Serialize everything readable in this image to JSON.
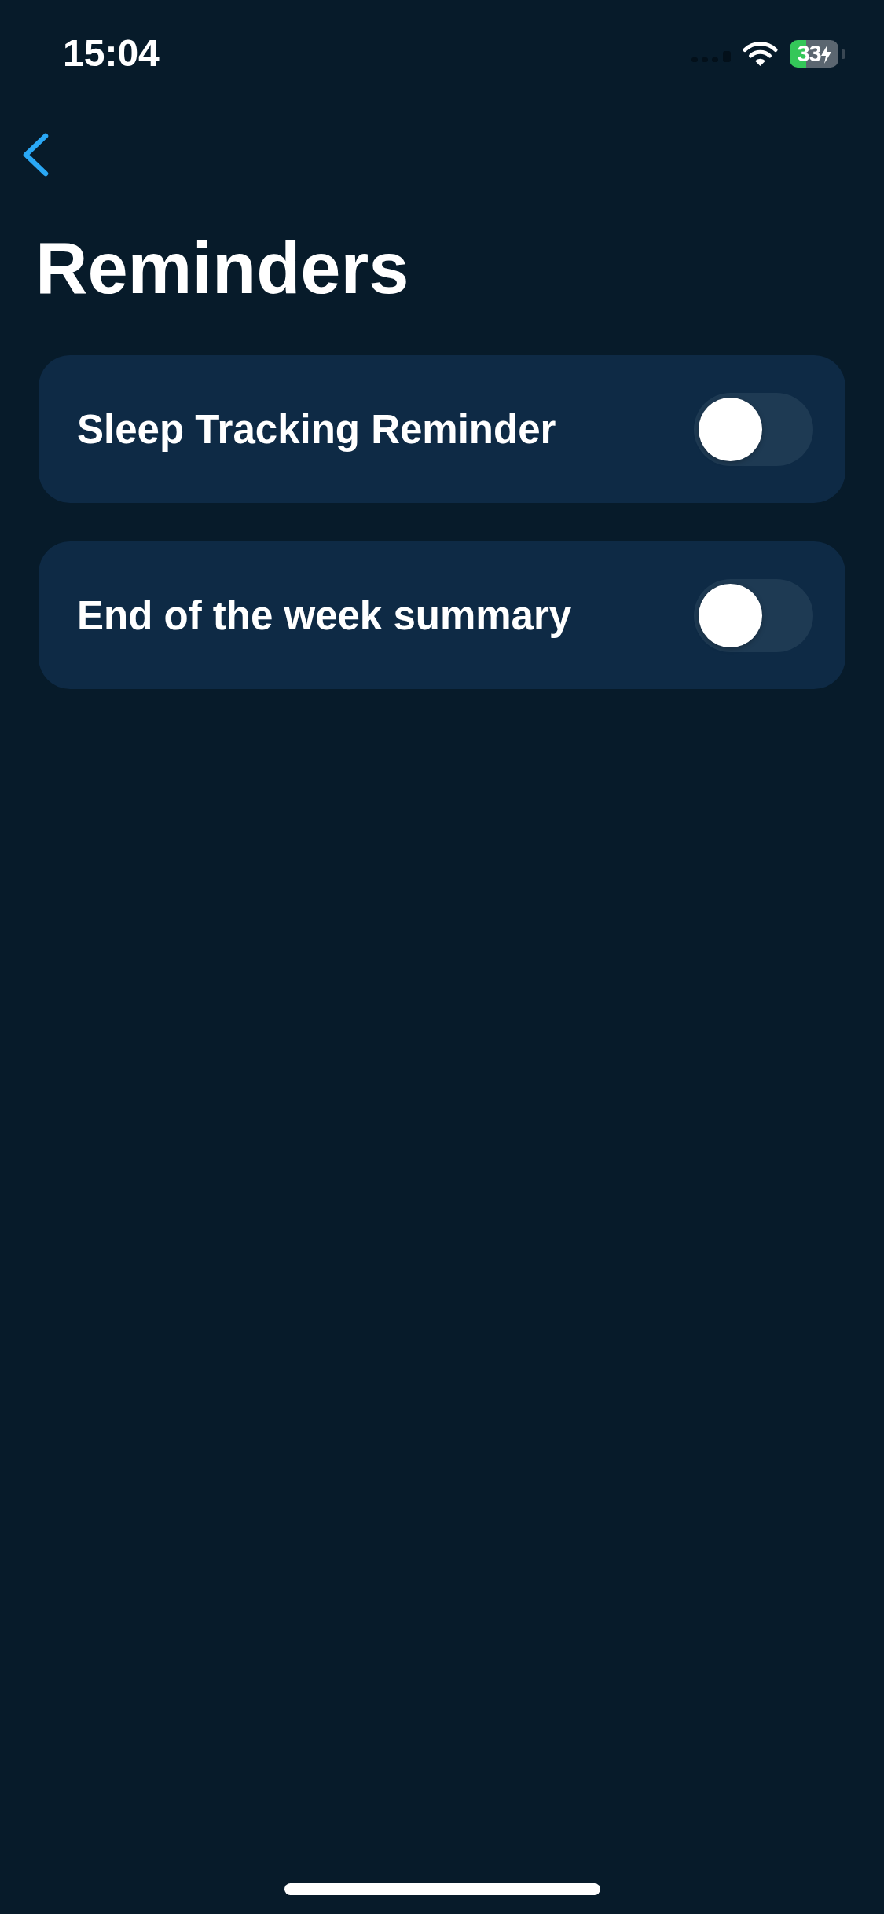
{
  "status_bar": {
    "time": "15:04",
    "battery_percentage": "33"
  },
  "title": "Reminders",
  "reminders": [
    {
      "label": "Sleep Tracking Reminder",
      "on": false
    },
    {
      "label": "End of the week summary",
      "on": false
    }
  ]
}
